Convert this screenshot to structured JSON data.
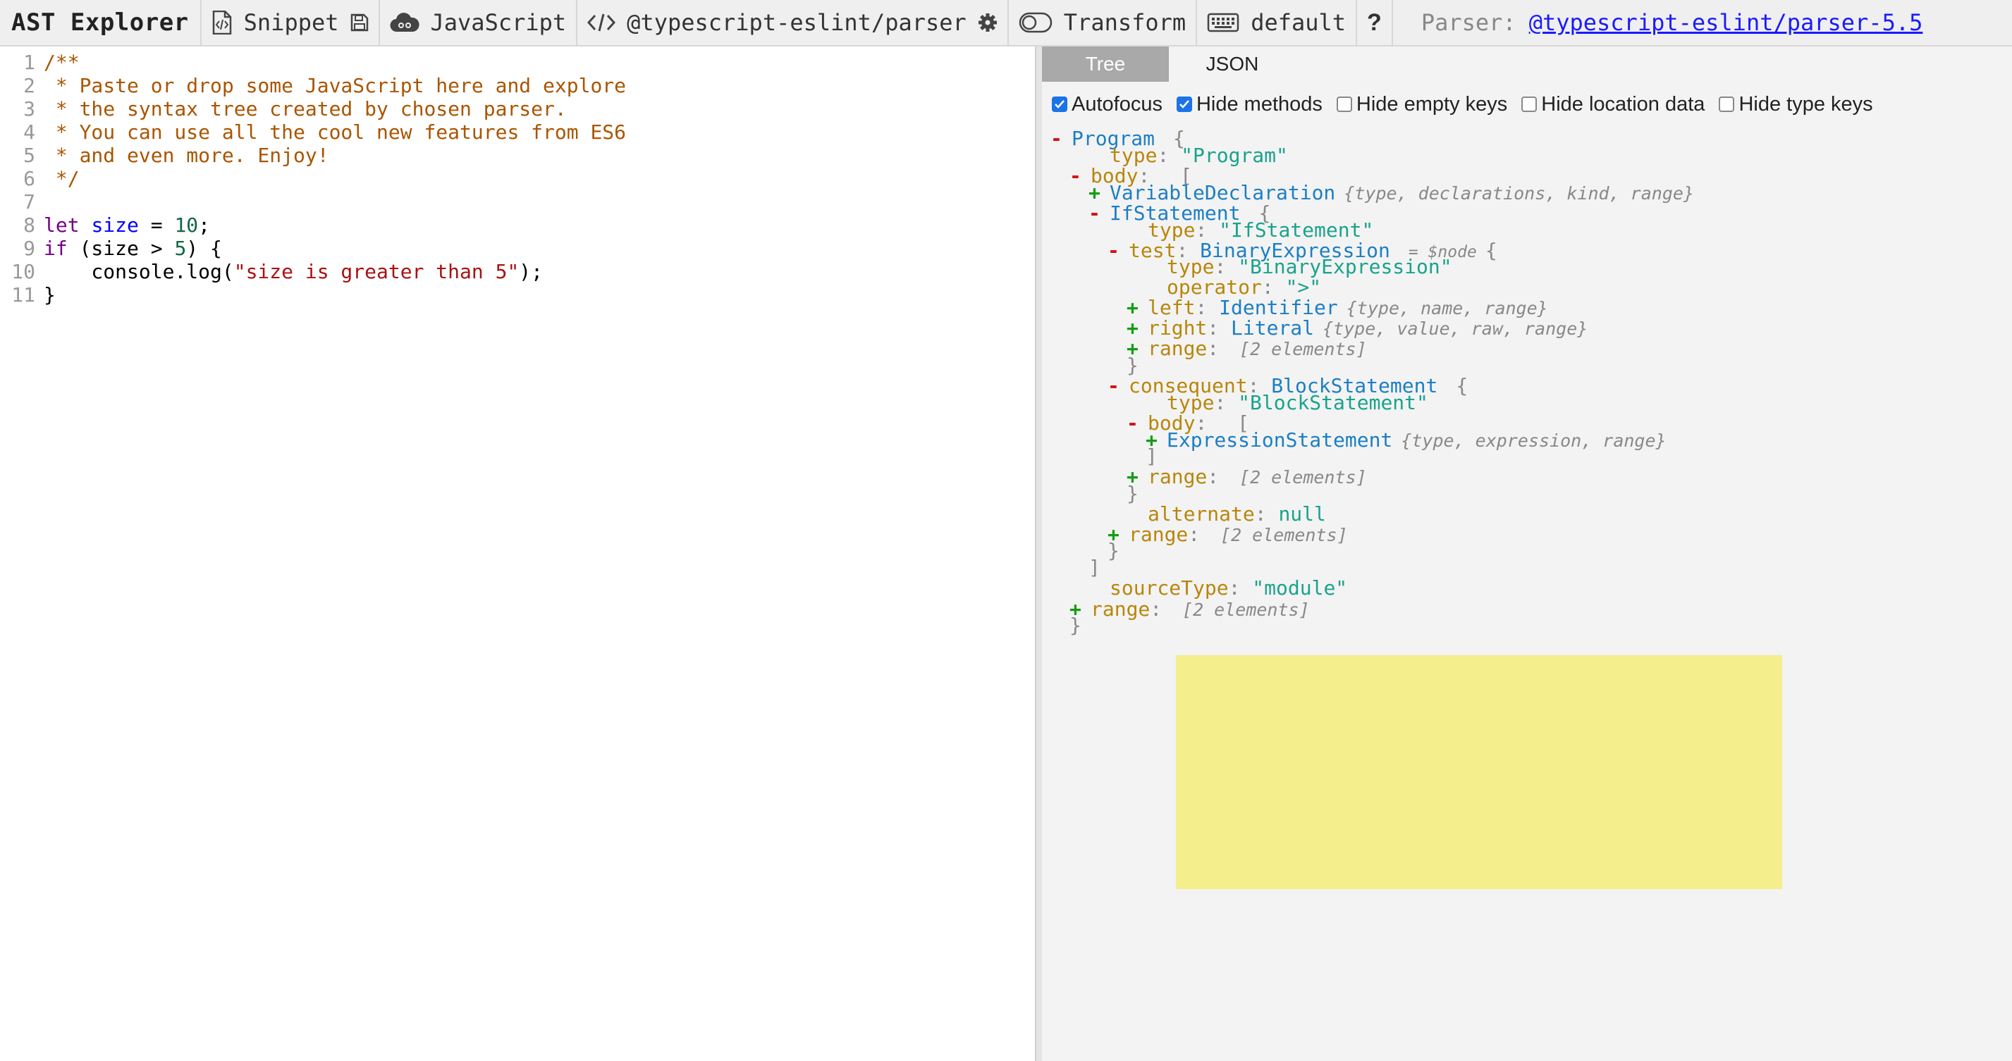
{
  "toolbar": {
    "title": "AST Explorer",
    "snippet_label": "Snippet",
    "language_label": "JavaScript",
    "parser_label": "@typescript-eslint/parser",
    "transform_label": "Transform",
    "keymap_label": "default",
    "help_label": "?",
    "parser_info_prefix": "Parser:",
    "parser_info_link": "@typescript-eslint/parser-5.5",
    "icons": [
      "snippet-icon",
      "save-icon",
      "cloud-icon",
      "code-icon",
      "gear-icon",
      "toggle-icon",
      "keyboard-icon",
      "help-icon"
    ]
  },
  "editor": {
    "lines": [
      {
        "num": "1",
        "segments": [
          {
            "t": "/**",
            "c": "comment"
          }
        ]
      },
      {
        "num": "2",
        "segments": [
          {
            "t": " * Paste or drop some JavaScript here and explore",
            "c": "comment"
          }
        ]
      },
      {
        "num": "3",
        "segments": [
          {
            "t": " * the syntax tree created by chosen parser.",
            "c": "comment"
          }
        ]
      },
      {
        "num": "4",
        "segments": [
          {
            "t": " * You can use all the cool new features from ES6",
            "c": "comment"
          }
        ]
      },
      {
        "num": "5",
        "segments": [
          {
            "t": " * and even more. Enjoy!",
            "c": "comment"
          }
        ]
      },
      {
        "num": "6",
        "segments": [
          {
            "t": " */",
            "c": "comment"
          }
        ]
      },
      {
        "num": "7",
        "segments": []
      },
      {
        "num": "8",
        "segments": [
          {
            "t": "let",
            "c": "kw"
          },
          {
            "t": " ",
            "c": "plain"
          },
          {
            "t": "size",
            "c": "def"
          },
          {
            "t": " = ",
            "c": "plain"
          },
          {
            "t": "10",
            "c": "num"
          },
          {
            "t": ";",
            "c": "plain"
          }
        ]
      },
      {
        "num": "9",
        "segments": [
          {
            "t": "if",
            "c": "kw"
          },
          {
            "t": " (size > ",
            "c": "plain"
          },
          {
            "t": "5",
            "c": "num"
          },
          {
            "t": ") {",
            "c": "plain"
          }
        ]
      },
      {
        "num": "10",
        "segments": [
          {
            "t": "    console.log(",
            "c": "plain"
          },
          {
            "t": "\"size is greater than 5\"",
            "c": "str"
          },
          {
            "t": ");",
            "c": "plain"
          }
        ]
      },
      {
        "num": "11",
        "segments": [
          {
            "t": "}",
            "c": "plain"
          }
        ]
      }
    ]
  },
  "output": {
    "tabs": [
      {
        "label": "Tree",
        "active": true
      },
      {
        "label": "JSON",
        "active": false
      }
    ],
    "options": [
      {
        "label": "Autofocus",
        "checked": true
      },
      {
        "label": "Hide methods",
        "checked": true
      },
      {
        "label": "Hide empty keys",
        "checked": false
      },
      {
        "label": "Hide location data",
        "checked": false
      },
      {
        "label": "Hide type keys",
        "checked": false
      }
    ],
    "tree": [
      {
        "toggle": "-",
        "key": "",
        "type": "Program",
        "open": "{",
        "indent": 0
      },
      {
        "key": "type",
        "string": "\"Program\"",
        "indent": 2
      },
      {
        "toggle": "-",
        "key": "body",
        "open": "[",
        "indent": 1
      },
      {
        "toggle": "+",
        "key": "",
        "type": "VariableDeclaration",
        "summary": "{type, declarations, kind, range}",
        "indent": 2
      },
      {
        "toggle": "-",
        "key": "",
        "type": "IfStatement",
        "open": "{",
        "indent": 2
      },
      {
        "key": "type",
        "string": "\"IfStatement\"",
        "indent": 4
      },
      {
        "toggle": "-",
        "key": "test",
        "type": "BinaryExpression",
        "hint": "= $node",
        "open": "{",
        "indent": 3
      },
      {
        "key": "type",
        "string": "\"BinaryExpression\"",
        "indent": 5
      },
      {
        "key": "operator",
        "string": "\">\"",
        "indent": 5
      },
      {
        "toggle": "+",
        "key": "left",
        "type": "Identifier",
        "summary": "{type, name, range}",
        "indent": 4
      },
      {
        "toggle": "+",
        "key": "right",
        "type": "Literal",
        "summary": "{type, value, raw, range}",
        "indent": 4
      },
      {
        "toggle": "+",
        "key": "range",
        "summary": "[2 elements]",
        "indent": 4
      },
      {
        "close": "}",
        "indent": 4
      },
      {
        "toggle": "-",
        "key": "consequent",
        "type": "BlockStatement",
        "open": "{",
        "indent": 3,
        "highlight": true
      },
      {
        "key": "type",
        "string": "\"BlockStatement\"",
        "indent": 5
      },
      {
        "toggle": "-",
        "key": "body",
        "open": "[",
        "indent": 4
      },
      {
        "toggle": "+",
        "key": "",
        "type": "ExpressionStatement",
        "summary": "{type, expression, range}",
        "indent": 5
      },
      {
        "close": "]",
        "indent": 5
      },
      {
        "toggle": "+",
        "key": "range",
        "summary": "[2 elements]",
        "indent": 4
      },
      {
        "close": "}",
        "indent": 4
      },
      {
        "key": "alternate",
        "null": "null",
        "indent": 4
      },
      {
        "toggle": "+",
        "key": "range",
        "summary": "[2 elements]",
        "indent": 3
      },
      {
        "close": "}",
        "indent": 3
      },
      {
        "close": "]",
        "indent": 2
      },
      {
        "key": "sourceType",
        "string": "\"module\"",
        "indent": 2
      },
      {
        "toggle": "+",
        "key": "range",
        "summary": "[2 elements]",
        "indent": 1
      },
      {
        "close": "}",
        "indent": 1
      }
    ]
  },
  "colors": {
    "highlight": "#f4ee8c",
    "link": "#1a1aff",
    "toggle_minus": "#d21313",
    "toggle_plus": "#139d13"
  }
}
